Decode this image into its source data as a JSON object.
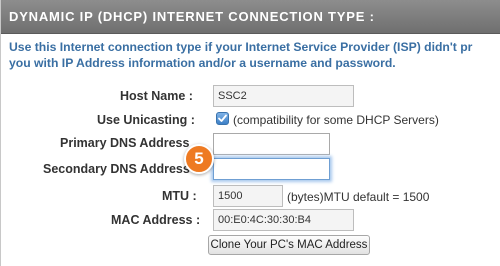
{
  "header": {
    "title": "DYNAMIC IP (DHCP) INTERNET CONNECTION TYPE :"
  },
  "description": {
    "line1": "Use this Internet connection type if your Internet Service Provider (ISP) didn't pr",
    "line2": "you with IP Address information and/or a username and password."
  },
  "form": {
    "host_name": {
      "label": "Host Name :",
      "value": "SSC2"
    },
    "use_unicasting": {
      "label": "Use Unicasting :",
      "checked": true,
      "note": "(compatibility for some DHCP Servers)"
    },
    "primary_dns": {
      "label": "Primary DNS Address",
      "value": ""
    },
    "secondary_dns": {
      "label": "Secondary DNS Address",
      "value": ""
    },
    "mtu": {
      "label": "MTU :",
      "value": "1500",
      "note": "(bytes)MTU default = 1500"
    },
    "mac_address": {
      "label": "MAC Address :",
      "value": "00:E0:4C:30:30:B4"
    },
    "clone_button": {
      "label": "Clone Your PC's MAC Address"
    }
  },
  "step_badge": {
    "number": "5",
    "color": "#ee7a22"
  },
  "colors": {
    "header": "#7d7d7d",
    "description_text": "#3a6fa3",
    "focus_glow": "#a9c9ee"
  }
}
